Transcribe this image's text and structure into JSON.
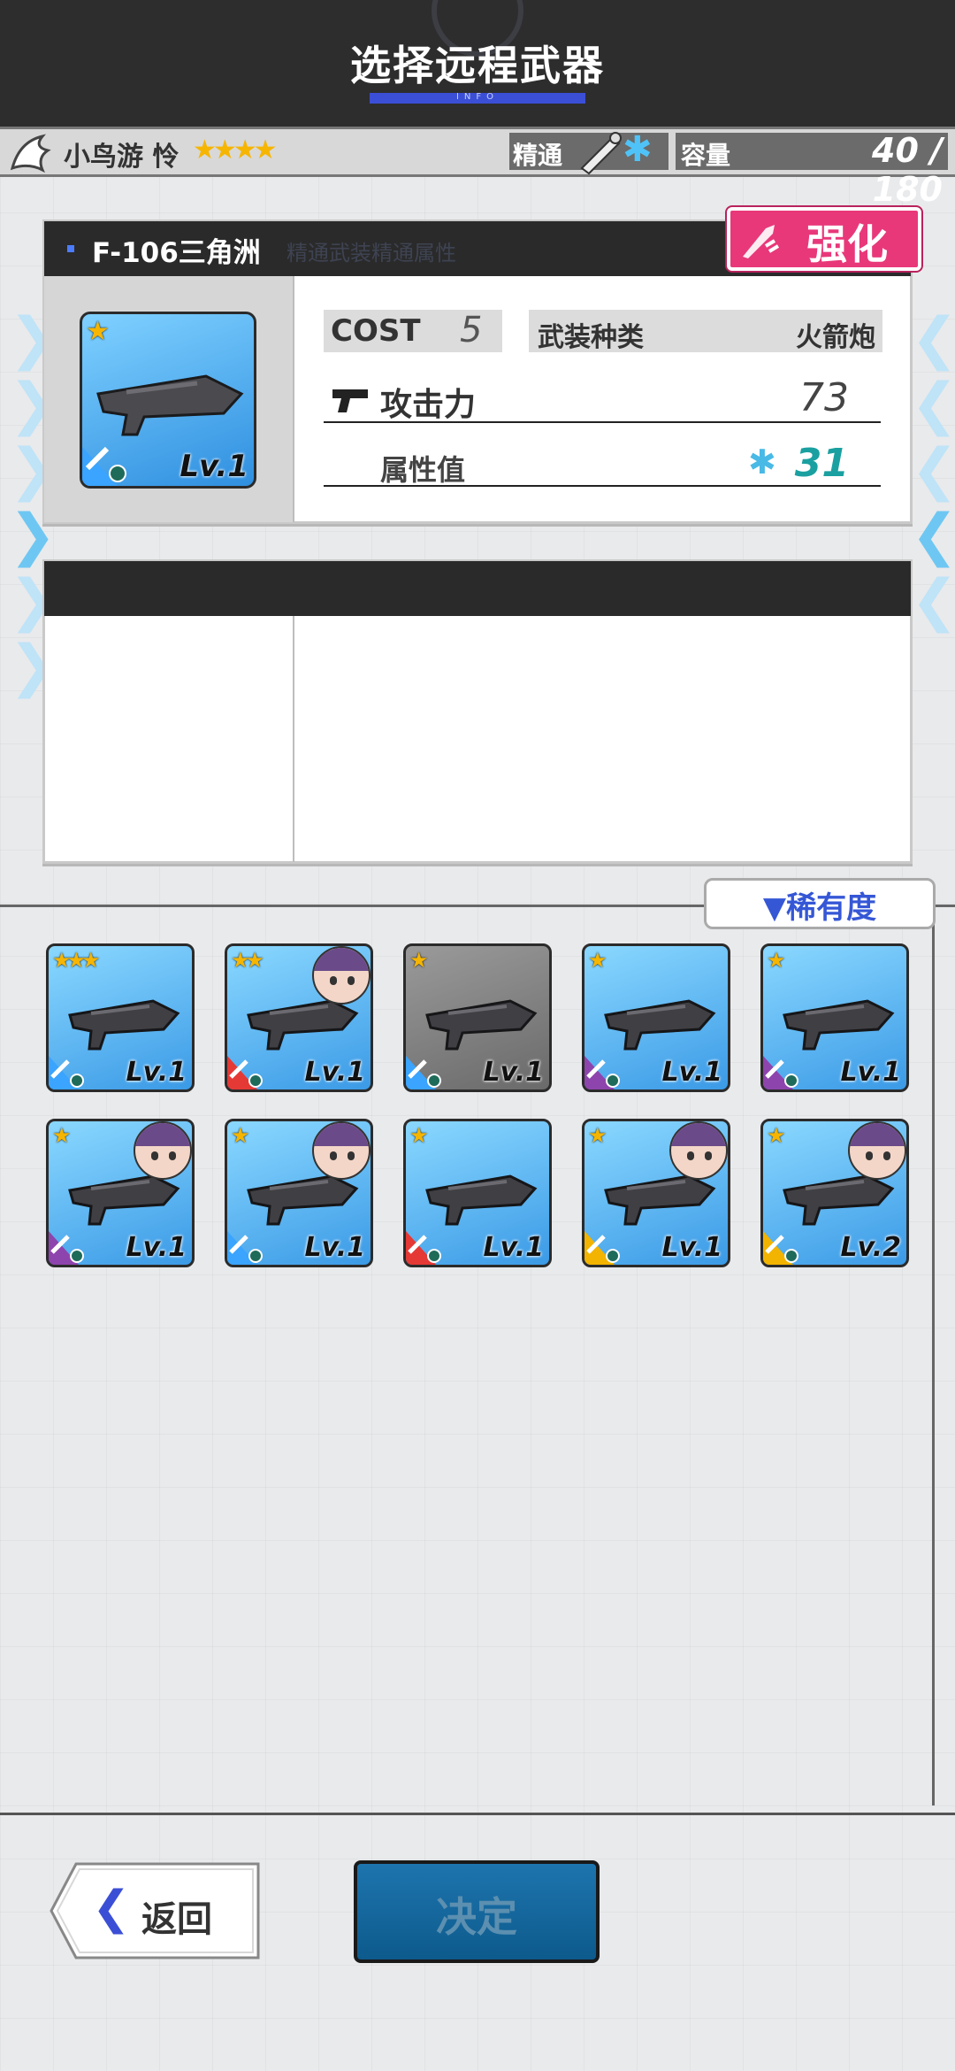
{
  "header": {
    "title": "选择远程武器",
    "subtitle": "INFO"
  },
  "status_bar": {
    "character_name": "小鸟游 怜",
    "character_stars": "★★★★",
    "mastery_label": "精通",
    "capacity_label": "容量",
    "capacity_value": "40 / 180"
  },
  "detail": {
    "weapon_name": "F-106三角洲",
    "weapon_note": "精通武装精通属性",
    "enhance_label": "强化",
    "card": {
      "stars": "★",
      "level": "Lv.1"
    },
    "cost_label": "COST",
    "cost_value": "5",
    "type_label": "武装种类",
    "type_value": "火箭炮",
    "attack_label": "攻击力",
    "attack_value": "73",
    "attribute_label": "属性值",
    "attribute_value": "31"
  },
  "sort": {
    "label": "▼稀有度"
  },
  "weapons": [
    {
      "stars": "★★★",
      "level": "Lv.1",
      "face": false,
      "bg": "blue",
      "tag_color": "#3aa4ff"
    },
    {
      "stars": "★★",
      "level": "Lv.1",
      "face": true,
      "bg": "blue",
      "tag_color": "#e53935"
    },
    {
      "stars": "★",
      "level": "Lv.1",
      "face": false,
      "bg": "gray",
      "tag_color": "#3aa4ff"
    },
    {
      "stars": "★",
      "level": "Lv.1",
      "face": false,
      "bg": "blue",
      "tag_color": "#8e44ad"
    },
    {
      "stars": "★",
      "level": "Lv.1",
      "face": false,
      "bg": "blue",
      "tag_color": "#8e44ad"
    },
    {
      "stars": "★",
      "level": "Lv.1",
      "face": true,
      "bg": "blue",
      "tag_color": "#8e44ad"
    },
    {
      "stars": "★",
      "level": "Lv.1",
      "face": true,
      "bg": "blue",
      "tag_color": "#3aa4ff"
    },
    {
      "stars": "★",
      "level": "Lv.1",
      "face": false,
      "bg": "blue",
      "tag_color": "#e53935"
    },
    {
      "stars": "★",
      "level": "Lv.1",
      "face": true,
      "bg": "blue",
      "tag_color": "#f2b400"
    },
    {
      "stars": "★",
      "level": "Lv.2",
      "face": true,
      "bg": "blue",
      "tag_color": "#f2b400"
    }
  ],
  "footer": {
    "back_label": "返回",
    "confirm_label": "决定"
  },
  "colors": {
    "accent": "#3b4fd6",
    "enhance": "#e8387a",
    "confirm": "#0d5a8c",
    "attribute": "#1aa0a0"
  }
}
